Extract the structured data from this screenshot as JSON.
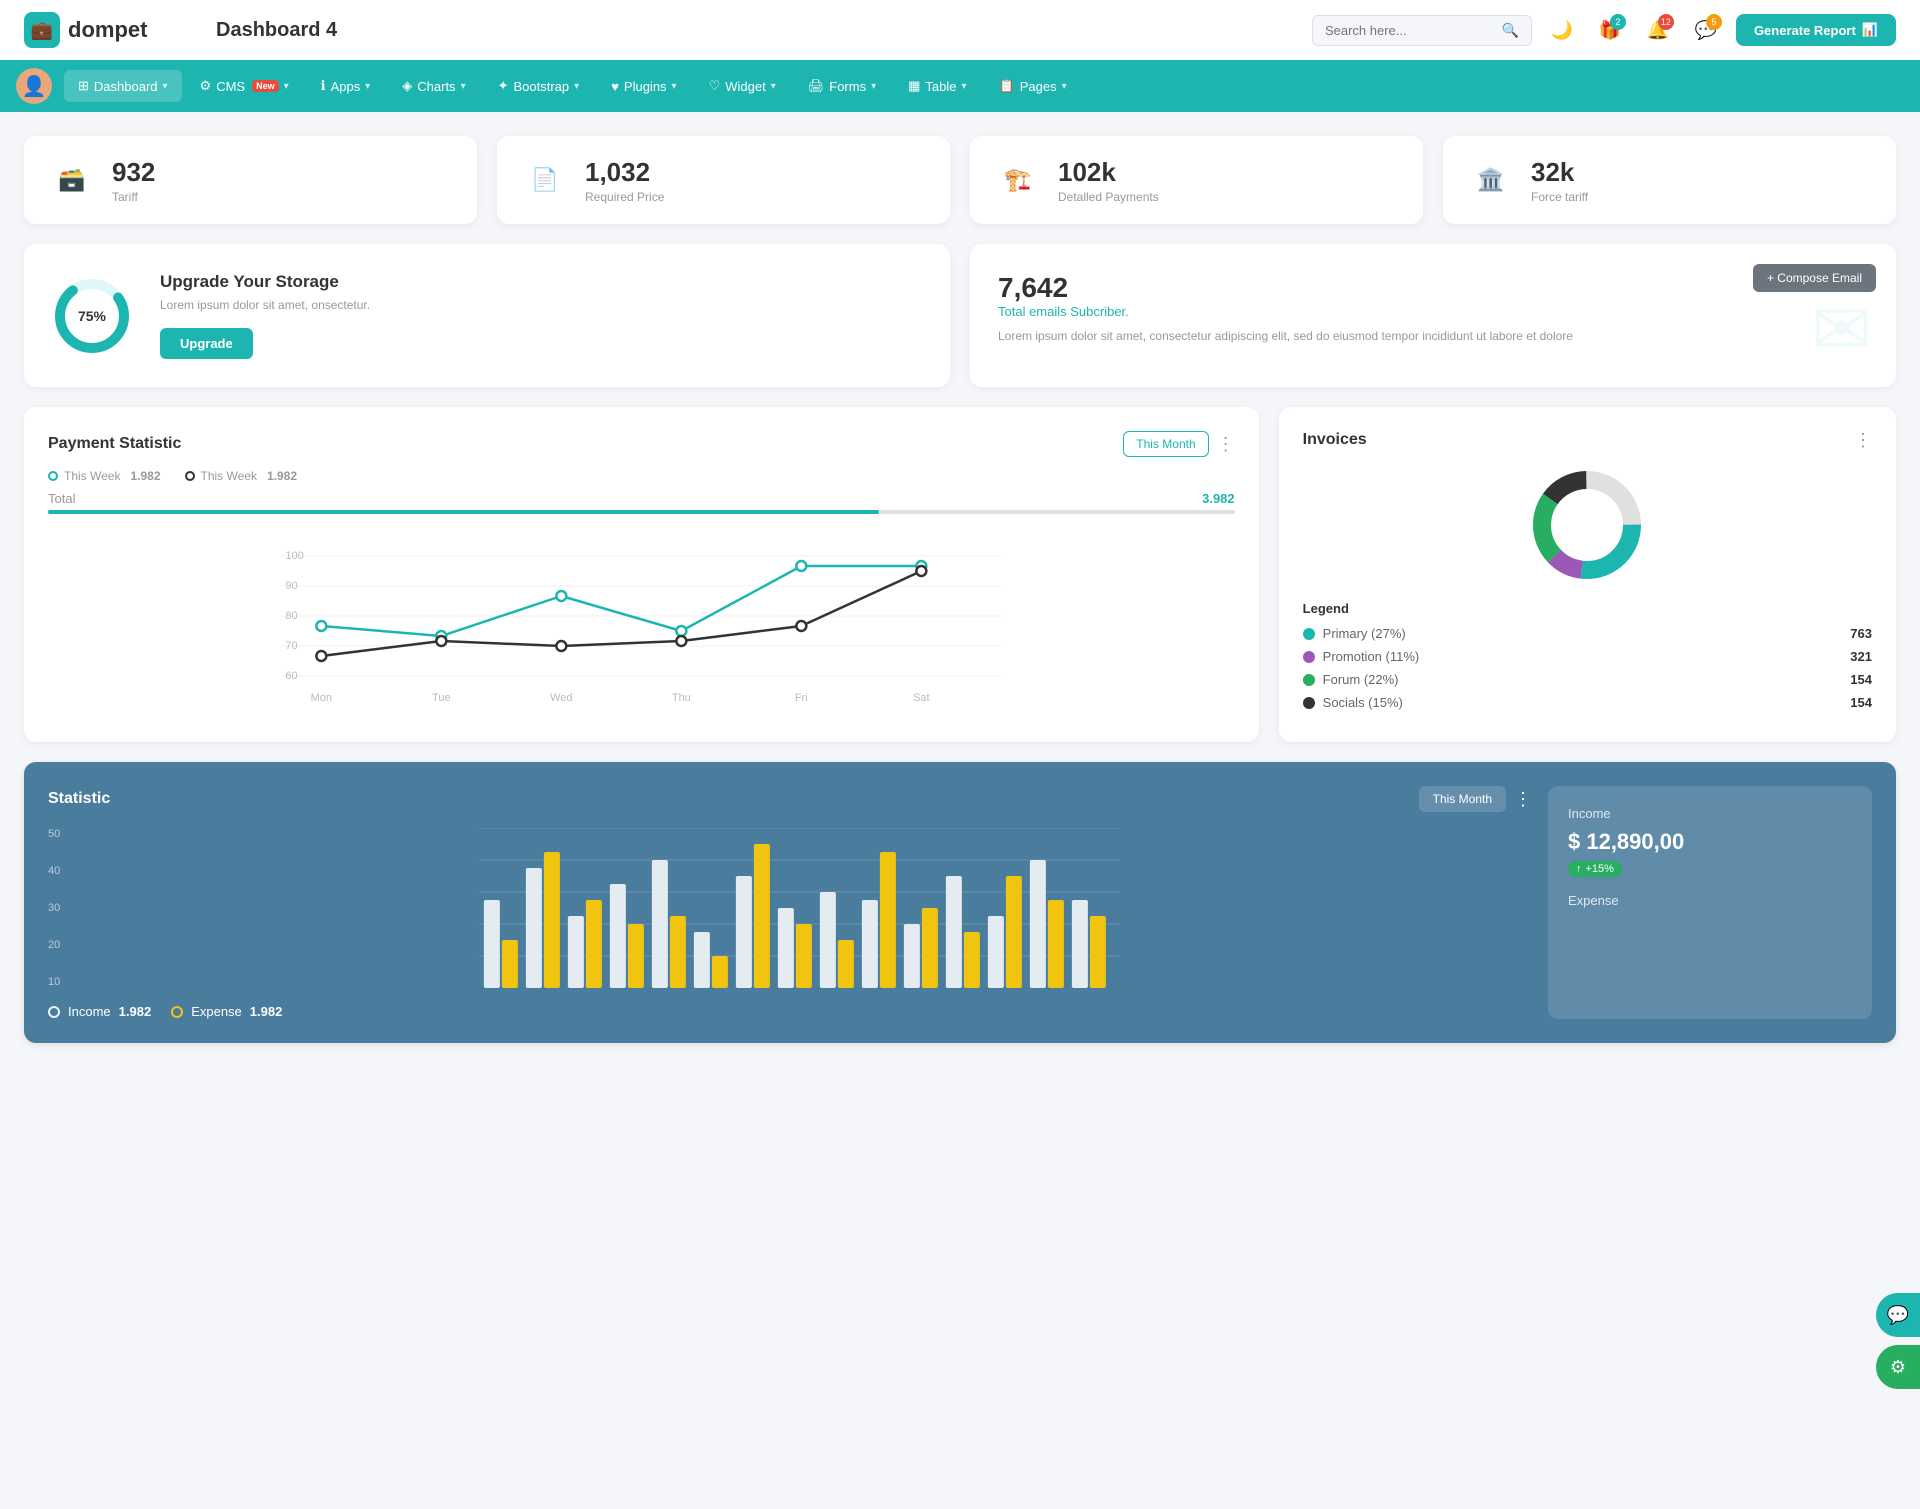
{
  "header": {
    "logo_text": "dompet",
    "page_title": "Dashboard 4",
    "search_placeholder": "Search here...",
    "generate_btn": "Generate Report",
    "badge_gift": "2",
    "badge_bell": "12",
    "badge_chat": "5"
  },
  "nav": {
    "items": [
      {
        "id": "dashboard",
        "label": "Dashboard",
        "active": true,
        "has_arrow": true
      },
      {
        "id": "cms",
        "label": "CMS",
        "active": false,
        "has_arrow": true,
        "badge": "New"
      },
      {
        "id": "apps",
        "label": "Apps",
        "active": false,
        "has_arrow": true
      },
      {
        "id": "charts",
        "label": "Charts",
        "active": false,
        "has_arrow": true
      },
      {
        "id": "bootstrap",
        "label": "Bootstrap",
        "active": false,
        "has_arrow": true
      },
      {
        "id": "plugins",
        "label": "Plugins",
        "active": false,
        "has_arrow": true
      },
      {
        "id": "widget",
        "label": "Widget",
        "active": false,
        "has_arrow": true
      },
      {
        "id": "forms",
        "label": "Forms",
        "active": false,
        "has_arrow": true
      },
      {
        "id": "table",
        "label": "Table",
        "active": false,
        "has_arrow": true
      },
      {
        "id": "pages",
        "label": "Pages",
        "active": false,
        "has_arrow": true
      }
    ]
  },
  "stat_cards": [
    {
      "id": "tariff",
      "number": "932",
      "label": "Tariff",
      "icon": "🗃️",
      "color": "teal"
    },
    {
      "id": "required-price",
      "number": "1,032",
      "label": "Required Price",
      "icon": "📄",
      "color": "red"
    },
    {
      "id": "detailed-payments",
      "number": "102k",
      "label": "Detalled Payments",
      "icon": "🏗️",
      "color": "purple"
    },
    {
      "id": "force-tariff",
      "number": "32k",
      "label": "Force tariff",
      "icon": "🏛️",
      "color": "pink"
    }
  ],
  "storage": {
    "percent": "75%",
    "title": "Upgrade Your Storage",
    "description": "Lorem ipsum dolor sit amet, onsectetur.",
    "btn_label": "Upgrade"
  },
  "email": {
    "number": "7,642",
    "subtitle": "Total emails Subcriber.",
    "description": "Lorem ipsum dolor sit amet, consectetur adipiscing elit, sed do eiusmod tempor incididunt ut labore et dolore",
    "compose_btn": "+ Compose Email"
  },
  "payment": {
    "title": "Payment Statistic",
    "filter_label": "This Month",
    "legend": [
      {
        "label": "This Week",
        "value": "1.982",
        "color": "teal"
      },
      {
        "label": "This Week",
        "value": "1.982",
        "color": "dark"
      }
    ],
    "total_label": "Total",
    "total_value": "3.982",
    "x_labels": [
      "Mon",
      "Tue",
      "Wed",
      "Thu",
      "Fri",
      "Sat"
    ]
  },
  "invoices": {
    "title": "Invoices",
    "legend": [
      {
        "label": "Primary (27%)",
        "value": "763",
        "color": "#1cb5b0"
      },
      {
        "label": "Promotion (11%)",
        "value": "321",
        "color": "#9b59b6"
      },
      {
        "label": "Forum (22%)",
        "value": "154",
        "color": "#27ae60"
      },
      {
        "label": "Socials (15%)",
        "value": "154",
        "color": "#333"
      }
    ]
  },
  "statistic": {
    "title": "Statistic",
    "filter_label": "This Month",
    "income_label": "Income",
    "income_value": "1.982",
    "expense_label": "Expense",
    "expense_value": "1.982",
    "income_panel": {
      "title": "Income",
      "amount": "$ 12,890,00",
      "badge": "+15%"
    },
    "expense_panel_title": "Expense",
    "bar_data": [
      {
        "white": 55,
        "yellow": 30
      },
      {
        "white": 75,
        "yellow": 85
      },
      {
        "white": 45,
        "yellow": 55
      },
      {
        "white": 65,
        "yellow": 40
      },
      {
        "white": 80,
        "yellow": 45
      },
      {
        "white": 35,
        "yellow": 20
      },
      {
        "white": 70,
        "yellow": 90
      },
      {
        "white": 50,
        "yellow": 40
      },
      {
        "white": 60,
        "yellow": 30
      },
      {
        "white": 55,
        "yellow": 85
      },
      {
        "white": 40,
        "yellow": 50
      },
      {
        "white": 70,
        "yellow": 35
      },
      {
        "white": 45,
        "yellow": 70
      },
      {
        "white": 80,
        "yellow": 55
      },
      {
        "white": 55,
        "yellow": 45
      }
    ],
    "y_labels": [
      "50",
      "40",
      "30",
      "20",
      "10"
    ]
  }
}
